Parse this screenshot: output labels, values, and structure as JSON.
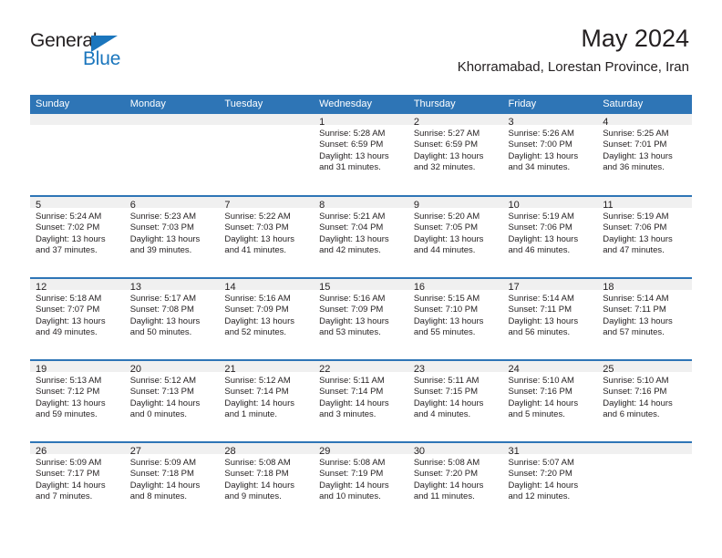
{
  "branding": {
    "name_part1": "General",
    "name_part2": "Blue",
    "accent_color": "#1b76bd",
    "triangle_icon": "triangle-icon"
  },
  "header": {
    "title": "May 2024",
    "location": "Khorramabad, Lorestan Province, Iran"
  },
  "calendar": {
    "header_background": "#2e75b6",
    "daynum_background": "#f0f0f0",
    "weekday_headers": [
      "Sunday",
      "Monday",
      "Tuesday",
      "Wednesday",
      "Thursday",
      "Friday",
      "Saturday"
    ],
    "weeks": [
      [
        {
          "day": "",
          "blank": true
        },
        {
          "day": "",
          "blank": true
        },
        {
          "day": "",
          "blank": true
        },
        {
          "day": "1",
          "sunrise": "Sunrise: 5:28 AM",
          "sunset": "Sunset: 6:59 PM",
          "daylight": "Daylight: 13 hours and 31 minutes."
        },
        {
          "day": "2",
          "sunrise": "Sunrise: 5:27 AM",
          "sunset": "Sunset: 6:59 PM",
          "daylight": "Daylight: 13 hours and 32 minutes."
        },
        {
          "day": "3",
          "sunrise": "Sunrise: 5:26 AM",
          "sunset": "Sunset: 7:00 PM",
          "daylight": "Daylight: 13 hours and 34 minutes."
        },
        {
          "day": "4",
          "sunrise": "Sunrise: 5:25 AM",
          "sunset": "Sunset: 7:01 PM",
          "daylight": "Daylight: 13 hours and 36 minutes."
        }
      ],
      [
        {
          "day": "5",
          "sunrise": "Sunrise: 5:24 AM",
          "sunset": "Sunset: 7:02 PM",
          "daylight": "Daylight: 13 hours and 37 minutes."
        },
        {
          "day": "6",
          "sunrise": "Sunrise: 5:23 AM",
          "sunset": "Sunset: 7:03 PM",
          "daylight": "Daylight: 13 hours and 39 minutes."
        },
        {
          "day": "7",
          "sunrise": "Sunrise: 5:22 AM",
          "sunset": "Sunset: 7:03 PM",
          "daylight": "Daylight: 13 hours and 41 minutes."
        },
        {
          "day": "8",
          "sunrise": "Sunrise: 5:21 AM",
          "sunset": "Sunset: 7:04 PM",
          "daylight": "Daylight: 13 hours and 42 minutes."
        },
        {
          "day": "9",
          "sunrise": "Sunrise: 5:20 AM",
          "sunset": "Sunset: 7:05 PM",
          "daylight": "Daylight: 13 hours and 44 minutes."
        },
        {
          "day": "10",
          "sunrise": "Sunrise: 5:19 AM",
          "sunset": "Sunset: 7:06 PM",
          "daylight": "Daylight: 13 hours and 46 minutes."
        },
        {
          "day": "11",
          "sunrise": "Sunrise: 5:19 AM",
          "sunset": "Sunset: 7:06 PM",
          "daylight": "Daylight: 13 hours and 47 minutes."
        }
      ],
      [
        {
          "day": "12",
          "sunrise": "Sunrise: 5:18 AM",
          "sunset": "Sunset: 7:07 PM",
          "daylight": "Daylight: 13 hours and 49 minutes."
        },
        {
          "day": "13",
          "sunrise": "Sunrise: 5:17 AM",
          "sunset": "Sunset: 7:08 PM",
          "daylight": "Daylight: 13 hours and 50 minutes."
        },
        {
          "day": "14",
          "sunrise": "Sunrise: 5:16 AM",
          "sunset": "Sunset: 7:09 PM",
          "daylight": "Daylight: 13 hours and 52 minutes."
        },
        {
          "day": "15",
          "sunrise": "Sunrise: 5:16 AM",
          "sunset": "Sunset: 7:09 PM",
          "daylight": "Daylight: 13 hours and 53 minutes."
        },
        {
          "day": "16",
          "sunrise": "Sunrise: 5:15 AM",
          "sunset": "Sunset: 7:10 PM",
          "daylight": "Daylight: 13 hours and 55 minutes."
        },
        {
          "day": "17",
          "sunrise": "Sunrise: 5:14 AM",
          "sunset": "Sunset: 7:11 PM",
          "daylight": "Daylight: 13 hours and 56 minutes."
        },
        {
          "day": "18",
          "sunrise": "Sunrise: 5:14 AM",
          "sunset": "Sunset: 7:11 PM",
          "daylight": "Daylight: 13 hours and 57 minutes."
        }
      ],
      [
        {
          "day": "19",
          "sunrise": "Sunrise: 5:13 AM",
          "sunset": "Sunset: 7:12 PM",
          "daylight": "Daylight: 13 hours and 59 minutes."
        },
        {
          "day": "20",
          "sunrise": "Sunrise: 5:12 AM",
          "sunset": "Sunset: 7:13 PM",
          "daylight": "Daylight: 14 hours and 0 minutes."
        },
        {
          "day": "21",
          "sunrise": "Sunrise: 5:12 AM",
          "sunset": "Sunset: 7:14 PM",
          "daylight": "Daylight: 14 hours and 1 minute."
        },
        {
          "day": "22",
          "sunrise": "Sunrise: 5:11 AM",
          "sunset": "Sunset: 7:14 PM",
          "daylight": "Daylight: 14 hours and 3 minutes."
        },
        {
          "day": "23",
          "sunrise": "Sunrise: 5:11 AM",
          "sunset": "Sunset: 7:15 PM",
          "daylight": "Daylight: 14 hours and 4 minutes."
        },
        {
          "day": "24",
          "sunrise": "Sunrise: 5:10 AM",
          "sunset": "Sunset: 7:16 PM",
          "daylight": "Daylight: 14 hours and 5 minutes."
        },
        {
          "day": "25",
          "sunrise": "Sunrise: 5:10 AM",
          "sunset": "Sunset: 7:16 PM",
          "daylight": "Daylight: 14 hours and 6 minutes."
        }
      ],
      [
        {
          "day": "26",
          "sunrise": "Sunrise: 5:09 AM",
          "sunset": "Sunset: 7:17 PM",
          "daylight": "Daylight: 14 hours and 7 minutes."
        },
        {
          "day": "27",
          "sunrise": "Sunrise: 5:09 AM",
          "sunset": "Sunset: 7:18 PM",
          "daylight": "Daylight: 14 hours and 8 minutes."
        },
        {
          "day": "28",
          "sunrise": "Sunrise: 5:08 AM",
          "sunset": "Sunset: 7:18 PM",
          "daylight": "Daylight: 14 hours and 9 minutes."
        },
        {
          "day": "29",
          "sunrise": "Sunrise: 5:08 AM",
          "sunset": "Sunset: 7:19 PM",
          "daylight": "Daylight: 14 hours and 10 minutes."
        },
        {
          "day": "30",
          "sunrise": "Sunrise: 5:08 AM",
          "sunset": "Sunset: 7:20 PM",
          "daylight": "Daylight: 14 hours and 11 minutes."
        },
        {
          "day": "31",
          "sunrise": "Sunrise: 5:07 AM",
          "sunset": "Sunset: 7:20 PM",
          "daylight": "Daylight: 14 hours and 12 minutes."
        },
        {
          "day": "",
          "blank": true
        }
      ]
    ]
  }
}
